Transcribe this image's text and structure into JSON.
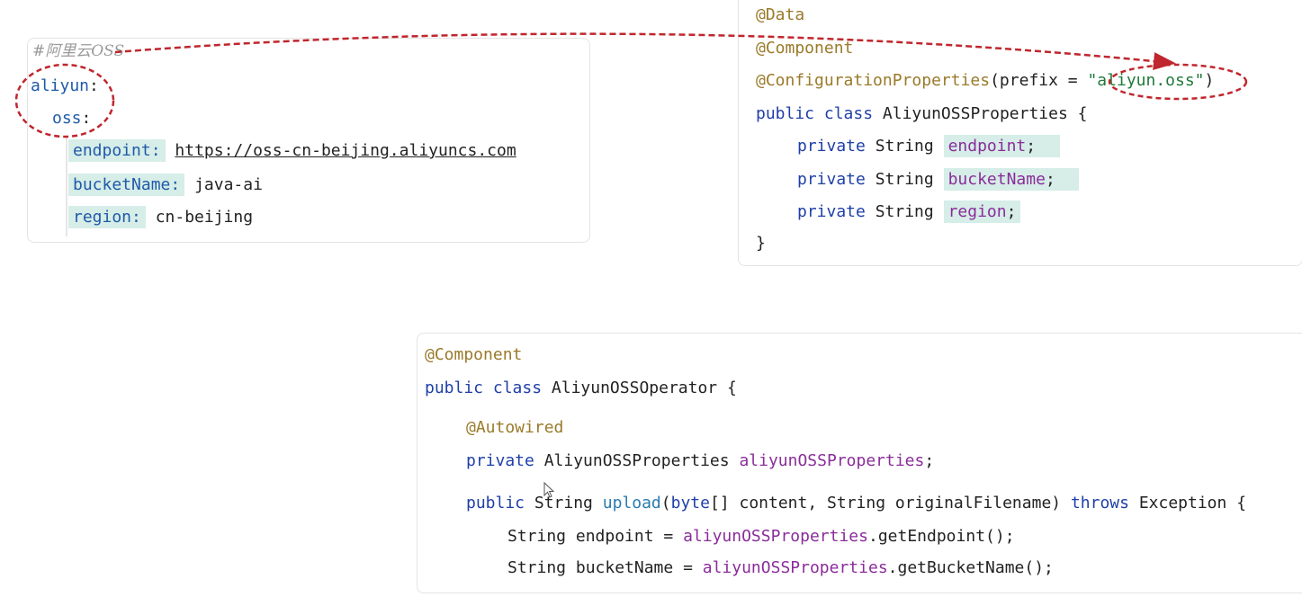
{
  "yaml": {
    "comment": "#阿里云OSS",
    "aliyun_key": "aliyun",
    "oss_key": "oss",
    "colon": ":",
    "endpoint_key": "endpoint:",
    "endpoint_value": "https://oss-cn-beijing.aliyuncs.com",
    "bucket_key": "bucketName:",
    "bucket_value": "java-ai",
    "region_key": "region:",
    "region_value": "cn-beijing"
  },
  "props": {
    "anno_data": "@Data",
    "anno_component": "@Component",
    "anno_config": "@ConfigurationProperties",
    "config_open": "(prefix = ",
    "prefix_value": "\"aliyun.oss\"",
    "config_close": ")",
    "kw_public": "public",
    "kw_class": "class",
    "class_name": "AliyunOSSProperties {",
    "kw_private": "private",
    "type_string": "String",
    "field_endpoint": "endpoint",
    "field_bucket": "bucketName",
    "field_region": "region",
    "semicolon": ";",
    "close_brace": "}"
  },
  "operator": {
    "anno_component": "@Component",
    "kw_public": "public",
    "kw_class": "class",
    "class_name": "AliyunOSSOperator {",
    "anno_autowired": "@Autowired",
    "kw_private": "private",
    "field_type": "AliyunOSSProperties",
    "field_name": "aliyunOSSProperties",
    "semicolon": ";",
    "type_string": "String",
    "method_name": "upload",
    "paren_open": "(",
    "kw_byte": "byte",
    "params_rest": "[] content, String originalFilename) ",
    "kw_throws": "throws",
    "exception": " Exception {",
    "line_endpoint_prefix": "String endpoint = ",
    "line_endpoint_obj": "aliyunOSSProperties",
    "line_endpoint_call": ".getEndpoint();",
    "line_bucket_prefix": "String bucketName = ",
    "line_bucket_obj": "aliyunOSSProperties",
    "line_bucket_call": ".getBucketName();"
  },
  "colors": {
    "annotation_circle": "#c0262d",
    "highlight_bg": "#d6ede8",
    "keyword": "#1f3fa8"
  }
}
